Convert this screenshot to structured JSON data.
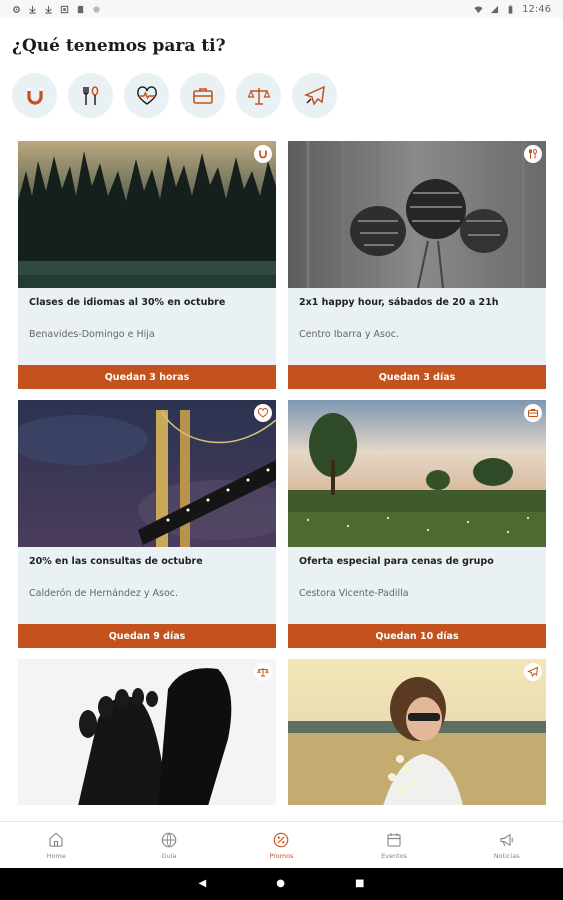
{
  "status_bar": {
    "time": "12:46"
  },
  "header": {
    "title": "¿Qué tenemos para ti?"
  },
  "categories": [
    {
      "icon": "magnet-icon"
    },
    {
      "icon": "restaurant-icon"
    },
    {
      "icon": "health-heart-icon"
    },
    {
      "icon": "briefcase-icon"
    },
    {
      "icon": "legal-scales-icon"
    },
    {
      "icon": "airplane-icon"
    }
  ],
  "promos": [
    {
      "title": "Clases de idiomas al 30% en octubre",
      "company": "Benavides-Domingo e Hija",
      "cta": "Quedan 3 horas",
      "badge_icon": "magnet-icon"
    },
    {
      "title": "2x1 happy hour, sábados de 20 a 21h",
      "company": "Centro Ibarra y Asoc.",
      "cta": "Quedan 3 días",
      "badge_icon": "restaurant-icon"
    },
    {
      "title": "20% en las consultas de octubre",
      "company": "Calderón de Hernández y Asoc.",
      "cta": "Quedan 9 días",
      "badge_icon": "health-heart-icon"
    },
    {
      "title": "Oferta especial para cenas de grupo",
      "company": "Cestora Vicente-Padilla",
      "cta": "Quedan 10 días",
      "badge_icon": "briefcase-icon"
    },
    {
      "title": "",
      "company": "",
      "cta": "",
      "badge_icon": "legal-scales-icon"
    },
    {
      "title": "",
      "company": "",
      "cta": "",
      "badge_icon": "airplane-icon"
    }
  ],
  "bottom_nav": [
    {
      "label": "Home",
      "icon": "home-icon"
    },
    {
      "label": "Guía",
      "icon": "globe-icon"
    },
    {
      "label": "Promos",
      "icon": "promo-tag-icon",
      "active": true
    },
    {
      "label": "Eventos",
      "icon": "calendar-icon"
    },
    {
      "label": "Noticias",
      "icon": "megaphone-icon"
    }
  ],
  "colors": {
    "accent": "#c4521c",
    "card_bg": "#eaf1f4",
    "icon_circle_bg": "#eaf1f4"
  }
}
